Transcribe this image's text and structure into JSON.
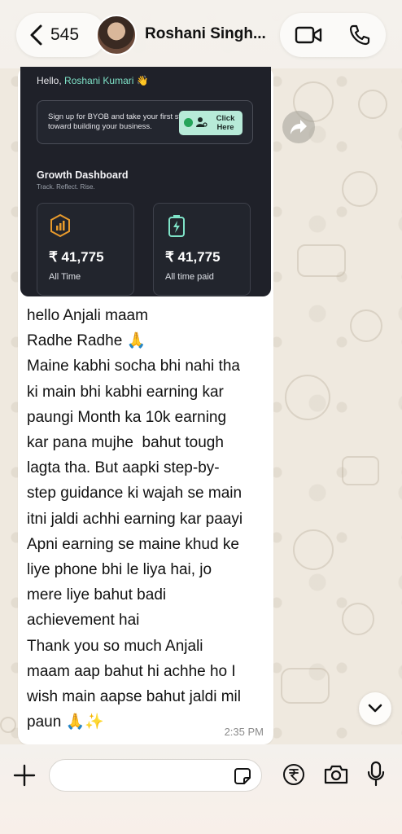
{
  "header": {
    "back_count": "545",
    "contact_name": "Roshani Singh..."
  },
  "message": {
    "image": {
      "greeting_prefix": "Hello,",
      "greeting_name": "Roshani Kumari",
      "greeting_emoji": "👋",
      "promo_text": "Sign up for BYOB and take your first step toward building your business.",
      "promo_button": "Click Here",
      "dashboard_title": "Growth Dashboard",
      "dashboard_subtitle": "Track. Reflect. Rise.",
      "cards": [
        {
          "value": "₹ 41,775",
          "label": "All Time",
          "icon": "chart-hexagon-icon"
        },
        {
          "value": "₹ 41,775",
          "label": "All time paid",
          "icon": "battery-bolt-icon"
        }
      ]
    },
    "text": "hello Anjali maam\nRadhe Radhe 🙏\nMaine kabhi socha bhi nahi tha\nki main bhi kabhi earning kar\npaungi Month ka 10k earning\nkar pana mujhe  bahut tough\nlagta tha. But aapki step-by-\nstep guidance ki wajah se main\nitni jaldi achhi earning kar paayi\nApni earning se maine khud ke\nliye phone bhi le liya hai, jo\nmere liye bahut badi\nachievement hai\nThank you so much Anjali\nmaam aap bahut hi achhe ho I\nwish main aapse bahut jaldi mil\npaun 🙏✨",
    "time": "2:35 PM"
  },
  "composer": {
    "placeholder": "",
    "value": ""
  },
  "icons": {
    "back": "chevron-left-icon",
    "video": "video-camera-icon",
    "phone": "phone-icon",
    "forward": "forward-arrow-icon",
    "scroll": "chevron-down-icon",
    "plus": "plus-icon",
    "sticker": "sticker-icon",
    "rupee": "rupee-icon",
    "camera": "camera-icon",
    "mic": "microphone-icon"
  },
  "colors": {
    "accent_green": "#7fe3c8",
    "dark_card": "#1f2129",
    "bubble": "#ffffff",
    "wallpaper": "#efe9df"
  }
}
